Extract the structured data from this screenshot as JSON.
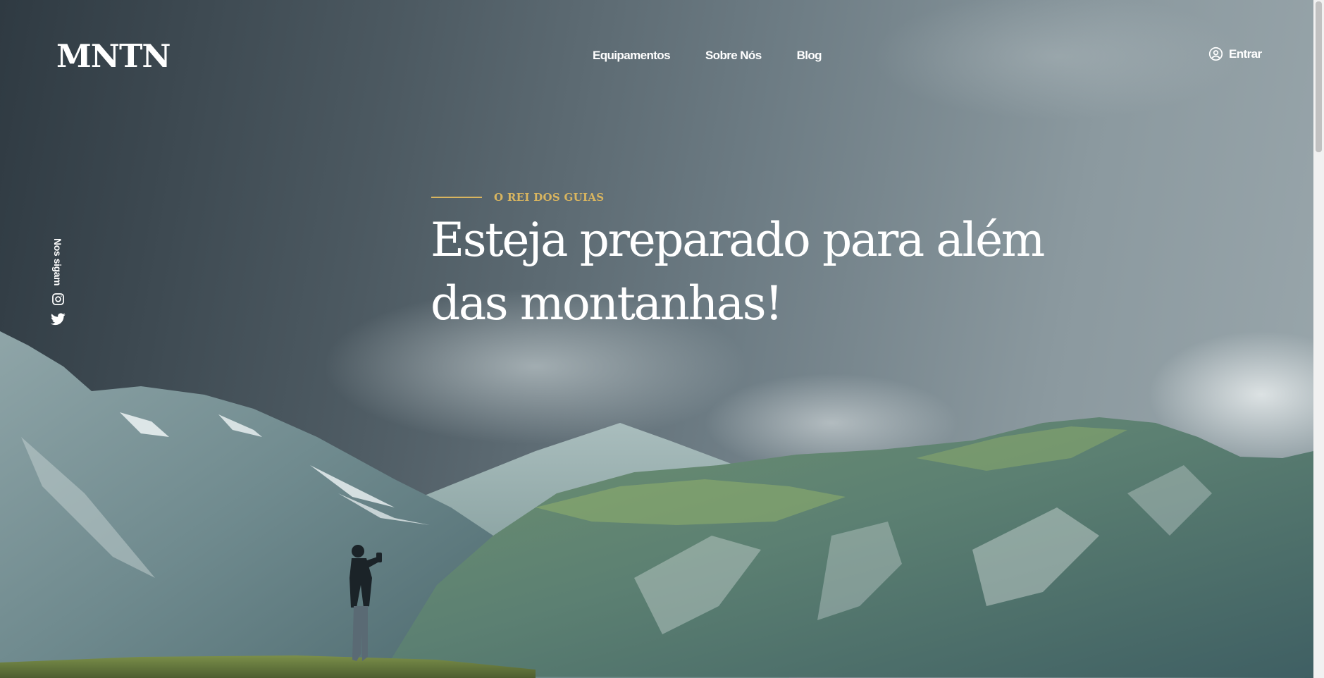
{
  "brand": {
    "logo": "MNTN"
  },
  "nav": {
    "items": [
      {
        "label": "Equipamentos"
      },
      {
        "label": "Sobre Nós"
      },
      {
        "label": "Blog"
      }
    ]
  },
  "account": {
    "login_label": "Entrar",
    "icon": "user-circle-icon"
  },
  "social": {
    "label": "Nos sigam",
    "links": [
      {
        "icon": "instagram-icon"
      },
      {
        "icon": "twitter-icon"
      }
    ]
  },
  "hero": {
    "eyebrow": "O REI DOS GUIAS",
    "headline_line1": "Esteja preparado para além",
    "headline_line2": "das montanhas!"
  },
  "colors": {
    "accent": "#d9b55f",
    "text": "#ffffff",
    "sky_dark": "#2f3a42",
    "sky_light": "#9aa7ac"
  }
}
